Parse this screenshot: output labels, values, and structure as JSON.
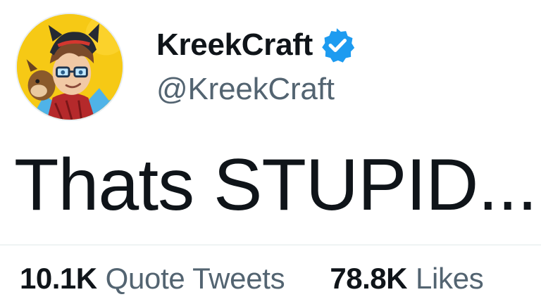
{
  "author": {
    "display_name": "KreekCraft",
    "handle": "@KreekCraft",
    "verified_badge_icon": "verified-badge-icon",
    "avatar_icon": "profile-avatar"
  },
  "tweet": {
    "text": "Thats STUPID..."
  },
  "stats": [
    {
      "count": "10.1K",
      "label": "Quote Tweets"
    },
    {
      "count": "78.8K",
      "label": "Likes"
    }
  ],
  "colors": {
    "text_primary": "#0f1419",
    "text_secondary": "#536471",
    "verified_blue": "#1d9bf0",
    "divider": "#eff3f4",
    "avatar_background": "#f6c915"
  }
}
